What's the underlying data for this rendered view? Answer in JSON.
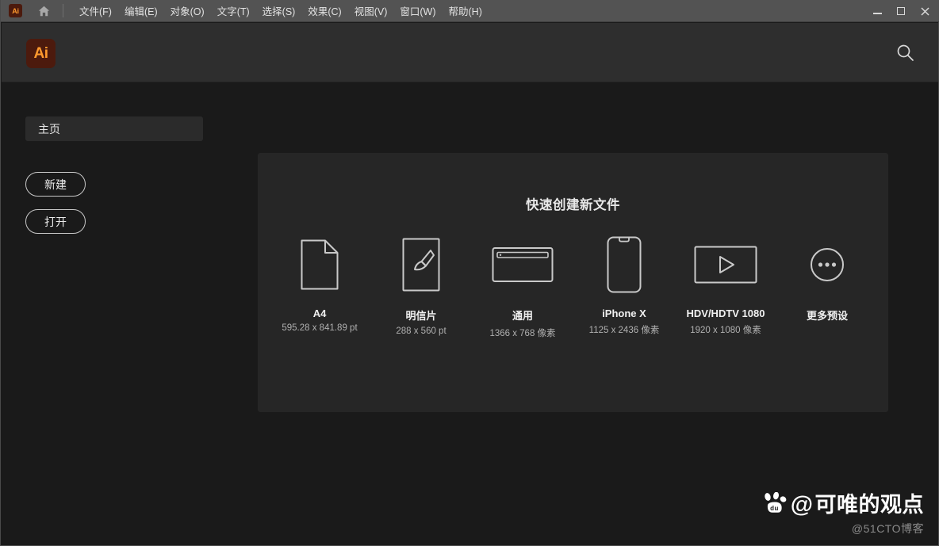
{
  "titlebar": {
    "app_icon": "ai-logo-icon",
    "home_icon": "home-icon",
    "menus": [
      {
        "label": "文件(F)"
      },
      {
        "label": "编辑(E)"
      },
      {
        "label": "对象(O)"
      },
      {
        "label": "文字(T)"
      },
      {
        "label": "选择(S)"
      },
      {
        "label": "效果(C)"
      },
      {
        "label": "视图(V)"
      },
      {
        "label": "窗口(W)"
      },
      {
        "label": "帮助(H)"
      }
    ],
    "window_controls": {
      "minimize": "minimize-icon",
      "maximize": "maximize-icon",
      "close": "close-icon"
    }
  },
  "header": {
    "logo_text": "Ai",
    "logo_bg": "#4c1a0d",
    "logo_fg": "#ff9a2e",
    "search_icon": "search-icon"
  },
  "sidebar": {
    "home_tab_label": "主页",
    "buttons": [
      {
        "label": "新建",
        "name": "new-button"
      },
      {
        "label": "打开",
        "name": "open-button"
      }
    ]
  },
  "main": {
    "panel_title": "快速创建新文件",
    "presets": [
      {
        "name": "A4",
        "size": "595.28 x 841.89 pt",
        "icon": "document-page-icon"
      },
      {
        "name": "明信片",
        "size": "288 x 560 pt",
        "icon": "paintbrush-card-icon"
      },
      {
        "name": "通用",
        "size": "1366 x 768 像素",
        "icon": "browser-window-icon"
      },
      {
        "name": "iPhone X",
        "size": "1125 x 2436 像素",
        "icon": "phone-notch-icon"
      },
      {
        "name": "HDV/HDTV 1080",
        "size": "1920 x 1080 像素",
        "icon": "video-play-icon"
      },
      {
        "name": "更多预设",
        "size": "",
        "icon": "more-dots-icon"
      }
    ]
  },
  "watermark": {
    "icon": "baidu-paw-icon",
    "at": "@",
    "handle": "可唯的观点",
    "source": "@51CTO博客"
  }
}
